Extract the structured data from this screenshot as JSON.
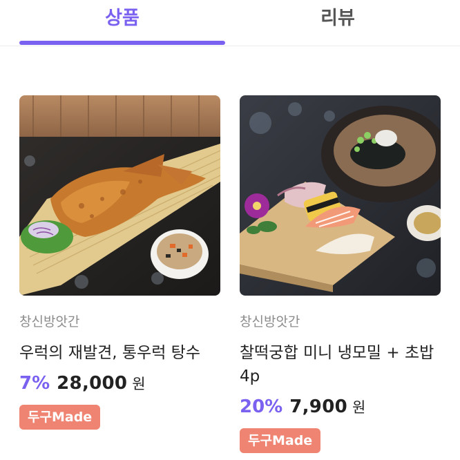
{
  "colors": {
    "accent": "#7b61f0",
    "badge": "#ef8472"
  },
  "tabs": [
    {
      "label": "상품",
      "active": true
    },
    {
      "label": "리뷰",
      "active": false
    }
  ],
  "products": [
    {
      "image_icon": "fried-fish-dish-photo",
      "store": "창신방앗간",
      "title": "우럭의 재발견, 통우럭 탕수",
      "discount": "7%",
      "price": "28,000",
      "currency": "원",
      "badge": "두구Made"
    },
    {
      "image_icon": "soba-and-sushi-photo",
      "store": "창신방앗간",
      "title": "찰떡궁합 미니 냉모밀 + 초밥 4p",
      "discount": "20%",
      "price": "7,900",
      "currency": "원",
      "badge": "두구Made"
    }
  ]
}
